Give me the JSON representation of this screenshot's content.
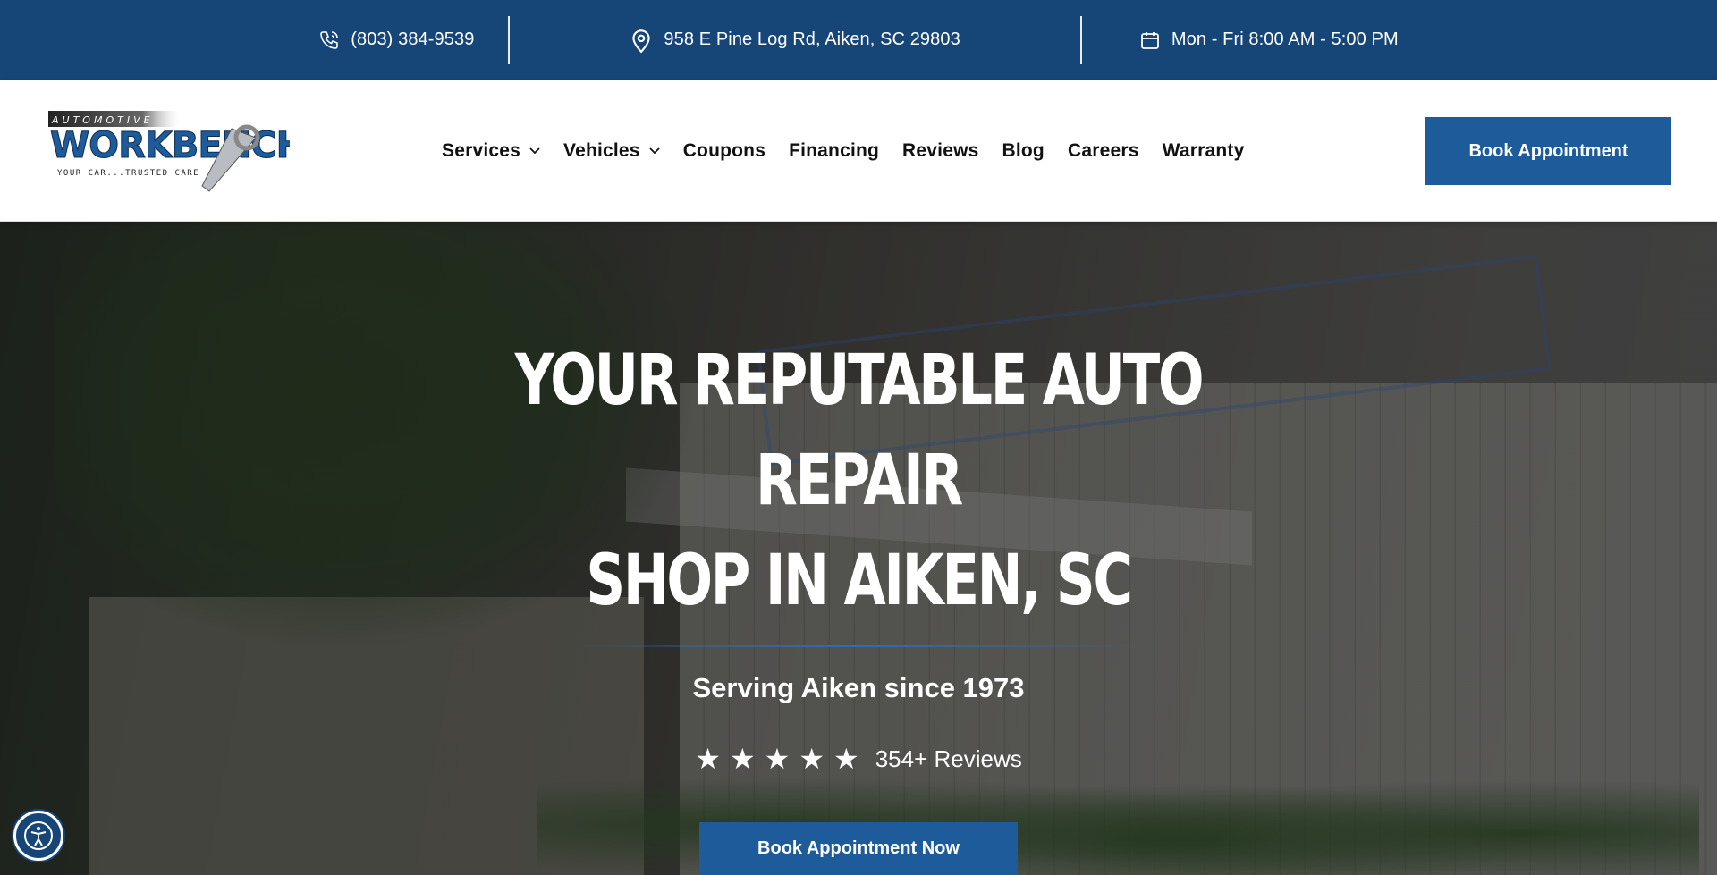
{
  "topbar": {
    "phone": "(803) 384-9539",
    "address": "958 E Pine Log Rd, Aiken, SC 29803",
    "hours": "Mon - Fri 8:00 AM - 5:00 PM",
    "icons": [
      "phone-icon",
      "location-pin-icon",
      "calendar-icon"
    ]
  },
  "logo": {
    "top": "AUTOMOTIVE",
    "main": "WORKBENCH",
    "tagline": "YOUR CAR...TRUSTED CARE"
  },
  "nav": {
    "items": [
      {
        "label": "Services",
        "dropdown": true
      },
      {
        "label": "Vehicles",
        "dropdown": true
      },
      {
        "label": "Coupons",
        "dropdown": false
      },
      {
        "label": "Financing",
        "dropdown": false
      },
      {
        "label": "Reviews",
        "dropdown": false
      },
      {
        "label": "Blog",
        "dropdown": false
      },
      {
        "label": "Careers",
        "dropdown": false
      },
      {
        "label": "Warranty",
        "dropdown": false
      }
    ],
    "cta": "Book Appointment"
  },
  "hero": {
    "title_line1": "YOUR REPUTABLE AUTO REPAIR",
    "title_line2": "SHOP IN AIKEN, SC",
    "subtitle": "Serving Aiken since 1973",
    "rating_stars": 5,
    "reviews": "354+ Reviews",
    "cta": "Book Appointment Now"
  },
  "colors": {
    "topbar": "#164677",
    "primary_button": "#1d5b9a"
  },
  "accessibility": {
    "icon": "accessibility-icon"
  }
}
